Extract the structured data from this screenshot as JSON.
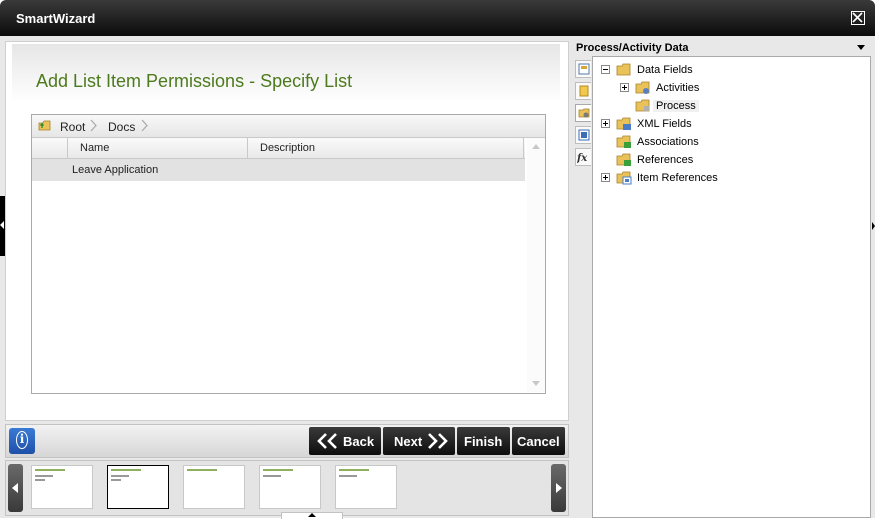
{
  "window": {
    "title": "SmartWizard"
  },
  "page": {
    "title": "Add List Item Permissions - Specify List"
  },
  "breadcrumb": {
    "items": [
      "Root",
      "Docs"
    ]
  },
  "list": {
    "columns": [
      "Name",
      "Description"
    ],
    "rows": [
      {
        "name": "Leave Application",
        "description": ""
      }
    ]
  },
  "buttons": {
    "back": "Back",
    "next": "Next",
    "finish": "Finish",
    "cancel": "Cancel"
  },
  "right_panel": {
    "title": "Process/Activity Data",
    "tree": [
      {
        "label": "Data Fields",
        "expander": "minus",
        "icon": "folder-icon"
      },
      {
        "label": "Activities",
        "expander": "plus",
        "icon": "folder-icon"
      },
      {
        "label": "Process",
        "expander": "none",
        "icon": "folder-icon",
        "selected": true
      },
      {
        "label": "XML Fields",
        "expander": "plus",
        "icon": "xml-folder-icon"
      },
      {
        "label": "Associations",
        "expander": "none",
        "icon": "association-folder-icon"
      },
      {
        "label": "References",
        "expander": "none",
        "icon": "reference-folder-icon"
      },
      {
        "label": "Item References",
        "expander": "plus",
        "icon": "item-reference-folder-icon"
      }
    ]
  },
  "colors": {
    "title_green": "#4c7a1c",
    "button_dark": "#1a1a1a",
    "info_blue": "#2a62c0"
  }
}
